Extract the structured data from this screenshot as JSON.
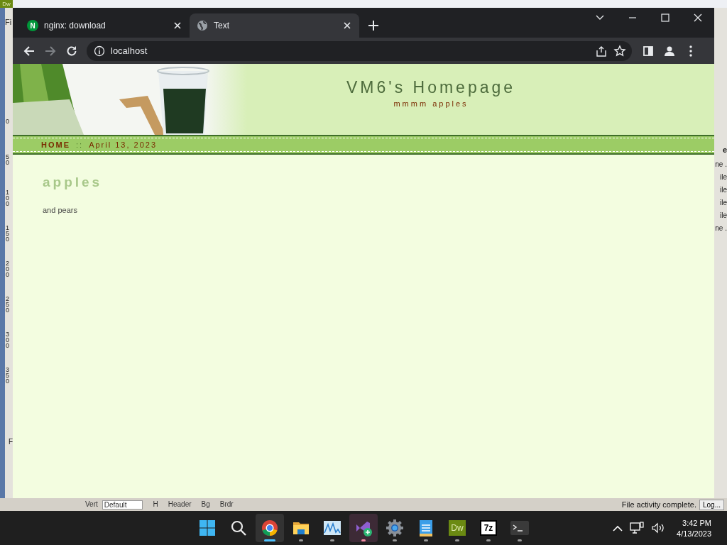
{
  "background_app": {
    "logo": "Dw",
    "menu_letter": "Fi",
    "ruler_labels": [
      "0",
      "50",
      "100",
      "150",
      "200",
      "250",
      "300",
      "350"
    ],
    "side_letter": "F",
    "right_panel": {
      "header": "e",
      "items": [
        "ne .",
        "ile",
        "ile",
        "ile",
        "ile",
        "ne ."
      ]
    },
    "properties": [
      "Vert",
      "Default",
      "H",
      "Header",
      "Bg",
      "Brdr"
    ],
    "status": "File activity complete.",
    "log_button": "Log..."
  },
  "browser": {
    "tabs": [
      {
        "title": "nginx: download",
        "kind": "lettered",
        "icon_letter": "N",
        "selected": false
      },
      {
        "title": "Text",
        "kind": "generic",
        "selected": true
      }
    ],
    "address": "localhost",
    "forward_disabled": true,
    "page": {
      "site_title": "VM6's Homepage",
      "tagline": "mmmm apples",
      "nav": {
        "home": "HOME",
        "separator": "::",
        "date": "April 13, 2023"
      },
      "heading": "apples",
      "body": "and pears"
    }
  },
  "taskbar": {
    "apps": [
      {
        "kind": "start",
        "selected": false,
        "running": false,
        "attention": false
      },
      {
        "kind": "search",
        "selected": false,
        "running": false,
        "attention": false
      },
      {
        "kind": "chrome",
        "selected": true,
        "running": true,
        "attention": false
      },
      {
        "kind": "folder",
        "selected": false,
        "running": true,
        "attention": false
      },
      {
        "kind": "monitor",
        "selected": false,
        "running": true,
        "attention": false
      },
      {
        "kind": "studio",
        "selected": false,
        "running": true,
        "attention": true
      },
      {
        "kind": "gear",
        "selected": false,
        "running": true,
        "attention": false
      },
      {
        "kind": "notepad",
        "selected": false,
        "running": true,
        "attention": false
      },
      {
        "kind": "tile",
        "label": "Dw",
        "selected": false,
        "running": true,
        "attention": false
      },
      {
        "kind": "tile7",
        "label": "7z",
        "selected": false,
        "running": true,
        "attention": false
      },
      {
        "kind": "terminal",
        "selected": false,
        "running": true,
        "attention": false
      }
    ],
    "time": "3:42 PM",
    "date": "4/13/2023"
  }
}
